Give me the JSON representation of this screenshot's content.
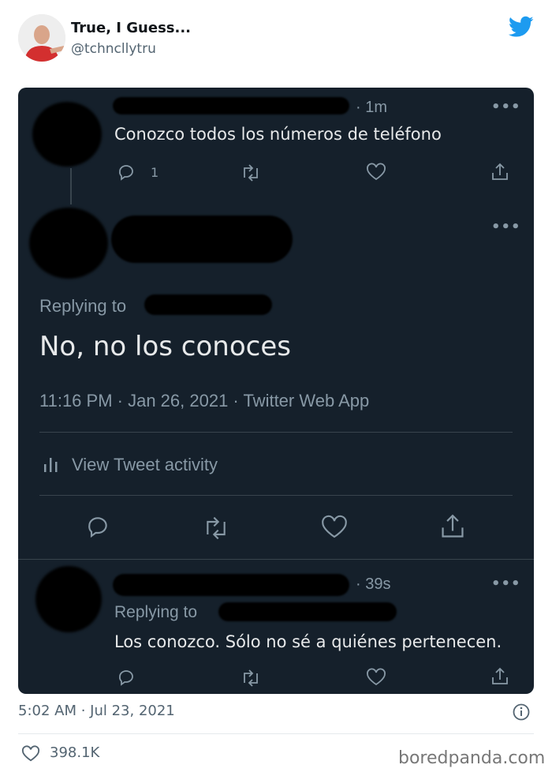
{
  "author": {
    "name": "True, I Guess...",
    "handle": "@tchncllytru"
  },
  "screenshot": {
    "tweet1": {
      "time": "· 1m",
      "text": "Conozco todos los números de teléfono",
      "reply_count": "1"
    },
    "main": {
      "replying_label": "Replying to",
      "text": "No, no los conoces",
      "meta": "11:16 PM · Jan 26, 2021 · Twitter Web App",
      "activity_label": "View Tweet activity"
    },
    "tweet3": {
      "time": "· 39s",
      "replying_label": "Replying to",
      "text": "Los conozco. Sólo no sé a quiénes pertenecen."
    }
  },
  "footer": {
    "timestamp": "5:02 AM · Jul 23, 2021",
    "likes": "398.1K",
    "watermark": "boredpanda.com"
  },
  "colors": {
    "twitter_blue": "#1d9bf0",
    "dark_bg": "#15202b",
    "muted": "#8899a6"
  },
  "icons": [
    "avatar",
    "twitter-bird-icon",
    "reply-icon",
    "retweet-icon",
    "like-icon",
    "share-icon",
    "more-icon",
    "activity-icon",
    "info-icon",
    "heart-icon"
  ]
}
